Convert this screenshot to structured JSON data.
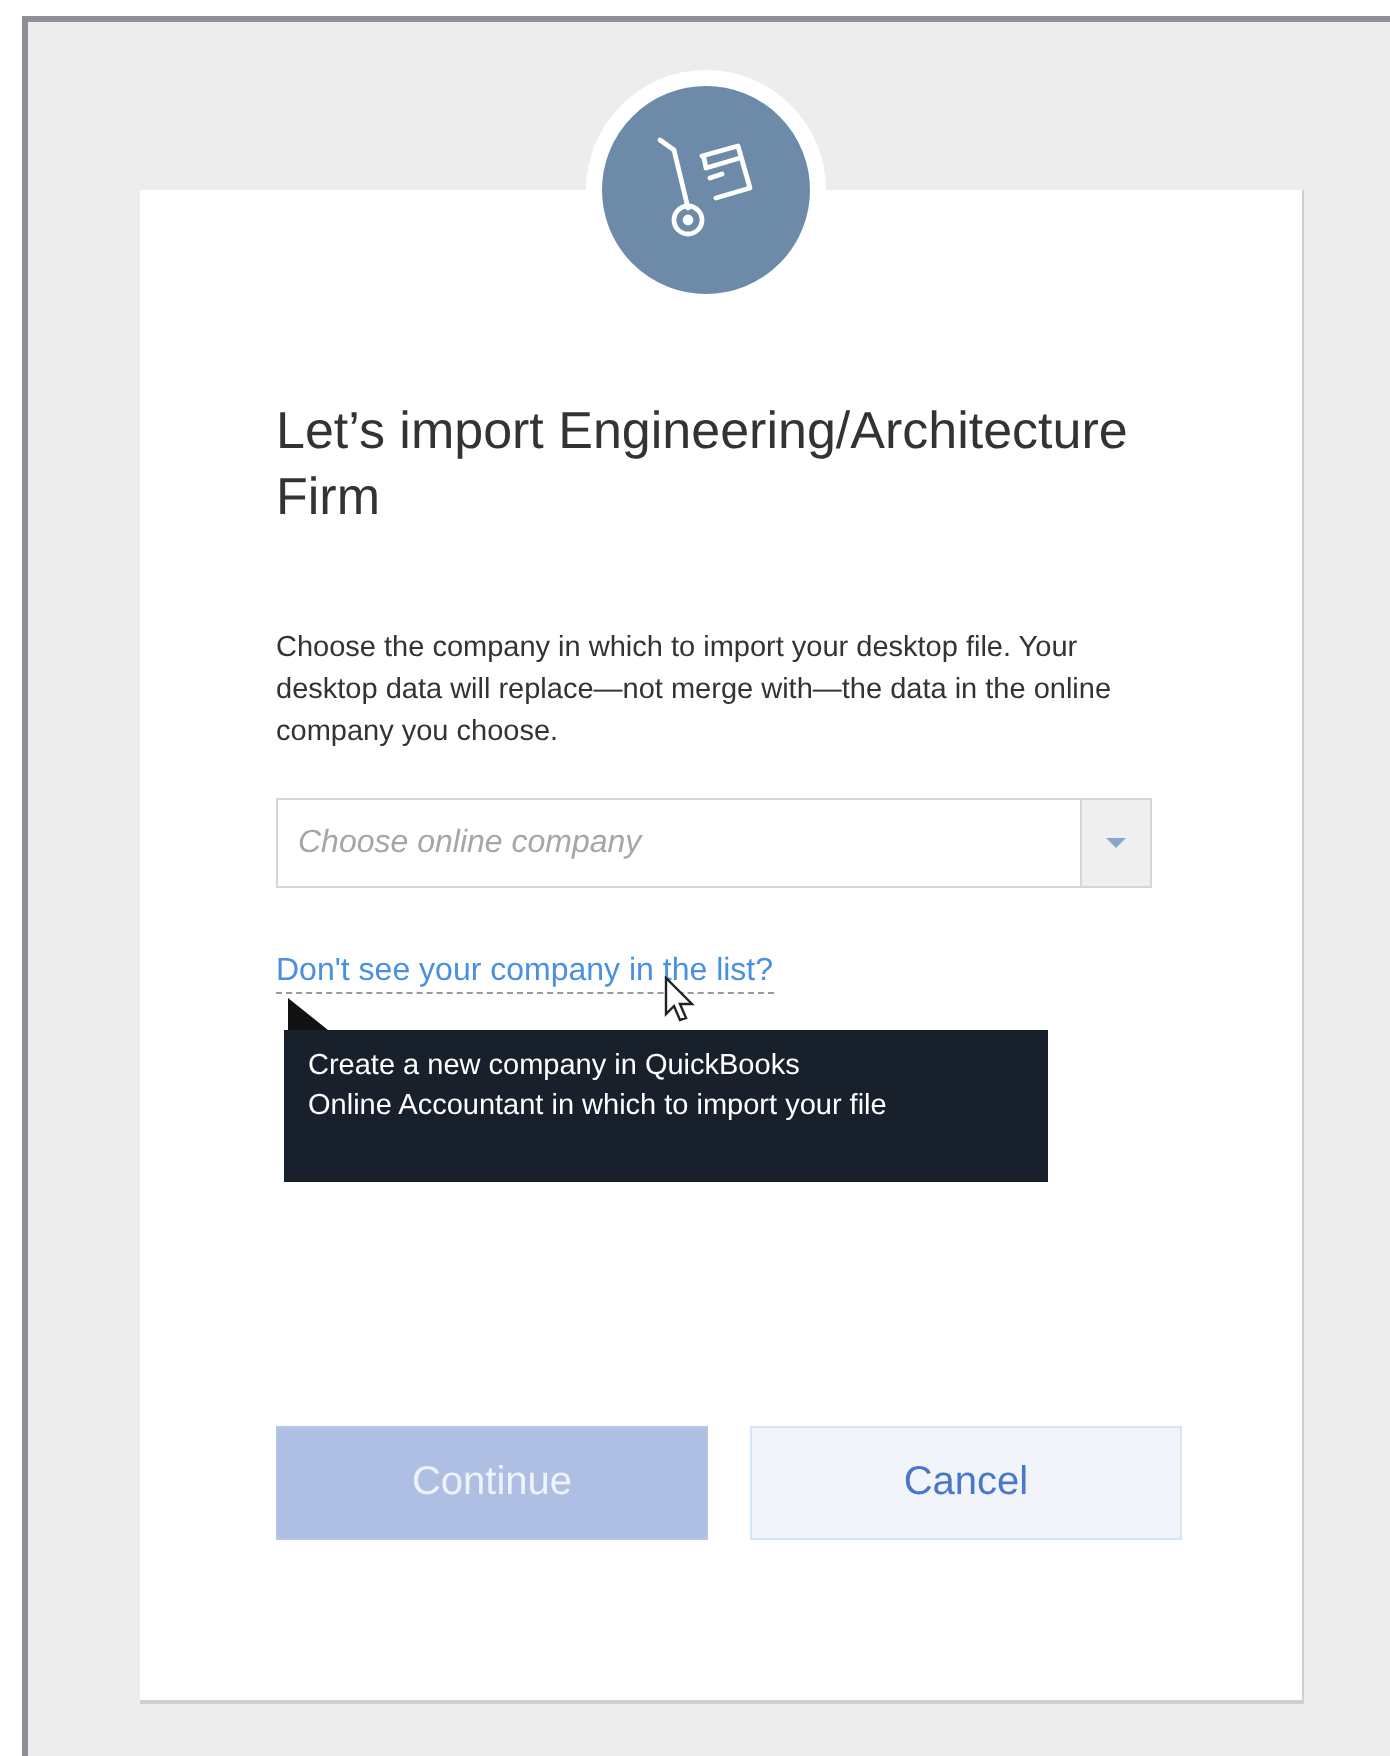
{
  "dialog": {
    "title": "Let’s import Engineering/Architecture Firm",
    "description": "Choose the company in which to import your desktop file. Your desktop data will replace—not merge with—the data in the online company you choose.",
    "company_select": {
      "placeholder": "Choose online company"
    },
    "help_link": {
      "label": "Don't see your company in the list?"
    },
    "tooltip": {
      "text": "Create a new company in QuickBooks Online Accountant in which to import your file"
    },
    "buttons": [
      {
        "label": "Continue",
        "kind": "primary",
        "disabled": true
      },
      {
        "label": "Cancel",
        "kind": "secondary",
        "disabled": false
      }
    ]
  }
}
